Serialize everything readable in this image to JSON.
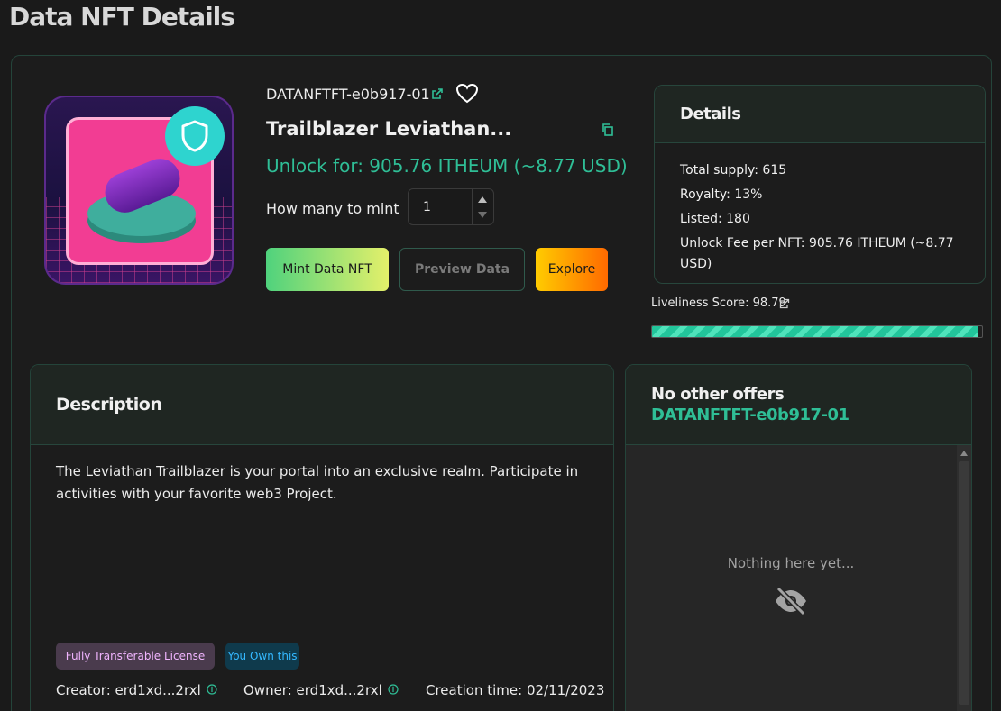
{
  "page": {
    "title": "Data NFT Details"
  },
  "nft": {
    "token_id": "DATANFTFT-e0b917-01",
    "title": "Trailblazer Leviathan...",
    "unlock_price": "Unlock for: 905.76 ITHEUM (~8.77 USD)"
  },
  "mint": {
    "label": "How many to mint",
    "quantity": "1"
  },
  "actions": {
    "mint_label": "Mint Data NFT",
    "preview_label": "Preview Data",
    "explore_label": "Explore"
  },
  "details": {
    "header": "Details",
    "total_supply": "Total supply: 615",
    "royalty": "Royalty: 13%",
    "listed": "Listed: 180",
    "unlock_fee": "Unlock Fee per NFT: 905.76 ITHEUM (~8.77 USD)"
  },
  "liveliness": {
    "label": "Liveliness Score: 98.79",
    "score_percent": 98.79
  },
  "description": {
    "header": "Description",
    "text": "The Leviathan Trailblazer is your portal into an exclusive realm. Participate in activities with your favorite web3 Project.",
    "badge_license": "Fully Transferable License",
    "badge_own": "You Own this",
    "creator": "Creator: erd1xd...2rxl",
    "owner": "Owner: erd1xd...2rxl",
    "creation_time": "Creation time: 02/11/2023"
  },
  "offers": {
    "title": "No other offers",
    "token": "DATANFTFT-e0b917-01",
    "empty_text": "Nothing here yet..."
  },
  "colors": {
    "accent_green": "#2fbe96",
    "background": "#1a1a1a"
  },
  "icons": [
    "external-link-icon",
    "heart-icon",
    "copy-icon",
    "shield-icon",
    "info-icon",
    "eye-off-icon"
  ]
}
